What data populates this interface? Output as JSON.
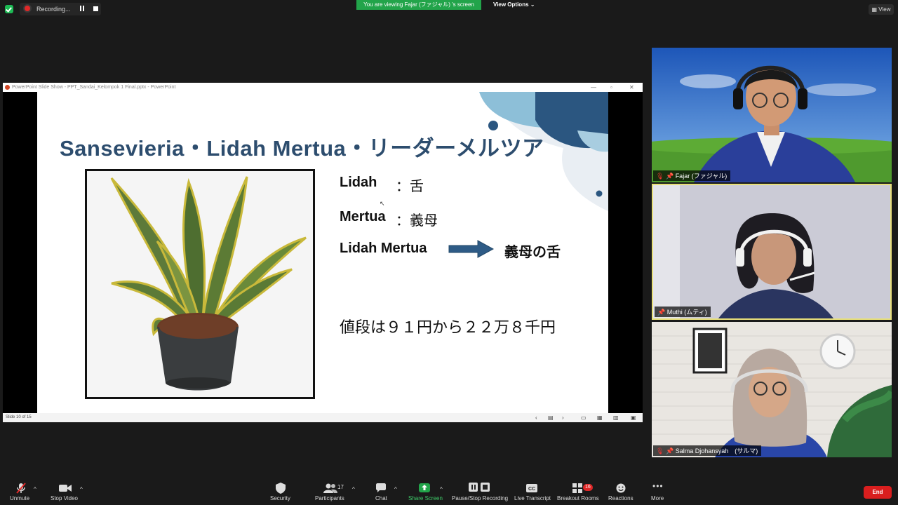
{
  "topbar": {
    "recording_label": "Recording...",
    "viewing_banner": "You are viewing Fajar (ファジャル) 's screen",
    "view_options_label": "View Options",
    "view_button_label": "View"
  },
  "ppt": {
    "title_bar": "PowerPoint Slide Show  -  PPT_Sandai_Kelompok 1 Final.pptx - PowerPoint",
    "status_slide": "Slide 10 of 15",
    "slide": {
      "title": "Sansevieria・Lidah Mertua・リーダーメルツア",
      "line1_term": "Lidah",
      "line1_meaning": "：舌",
      "line2_term": "Mertua",
      "line2_meaning": "：義母",
      "line3_term": "Lidah Mertua",
      "line3_meaning": "義母の舌",
      "price_text": "値段は９１円から２２万８千円"
    }
  },
  "participants": [
    {
      "name": "Fajar (ファジャル)"
    },
    {
      "name": "Muthi (ムティ)"
    },
    {
      "name": "Salma Djohansyah　(サルマ)"
    }
  ],
  "toolbar": {
    "unmute": "Unmute",
    "stop_video": "Stop Video",
    "security": "Security",
    "participants": "Participants",
    "participants_count": "17",
    "chat": "Chat",
    "share_screen": "Share Screen",
    "pause_stop_recording": "Pause/Stop Recording",
    "live_transcript": "Live Transcript",
    "breakout_rooms": "Breakout Rooms",
    "breakout_badge": "16",
    "reactions": "Reactions",
    "more": "More",
    "end": "End"
  },
  "colors": {
    "accent_green": "#22a44a",
    "end_red": "#d91e1e",
    "active_speaker_border": "#e8e07a",
    "slide_title": "#2d4d6e"
  }
}
